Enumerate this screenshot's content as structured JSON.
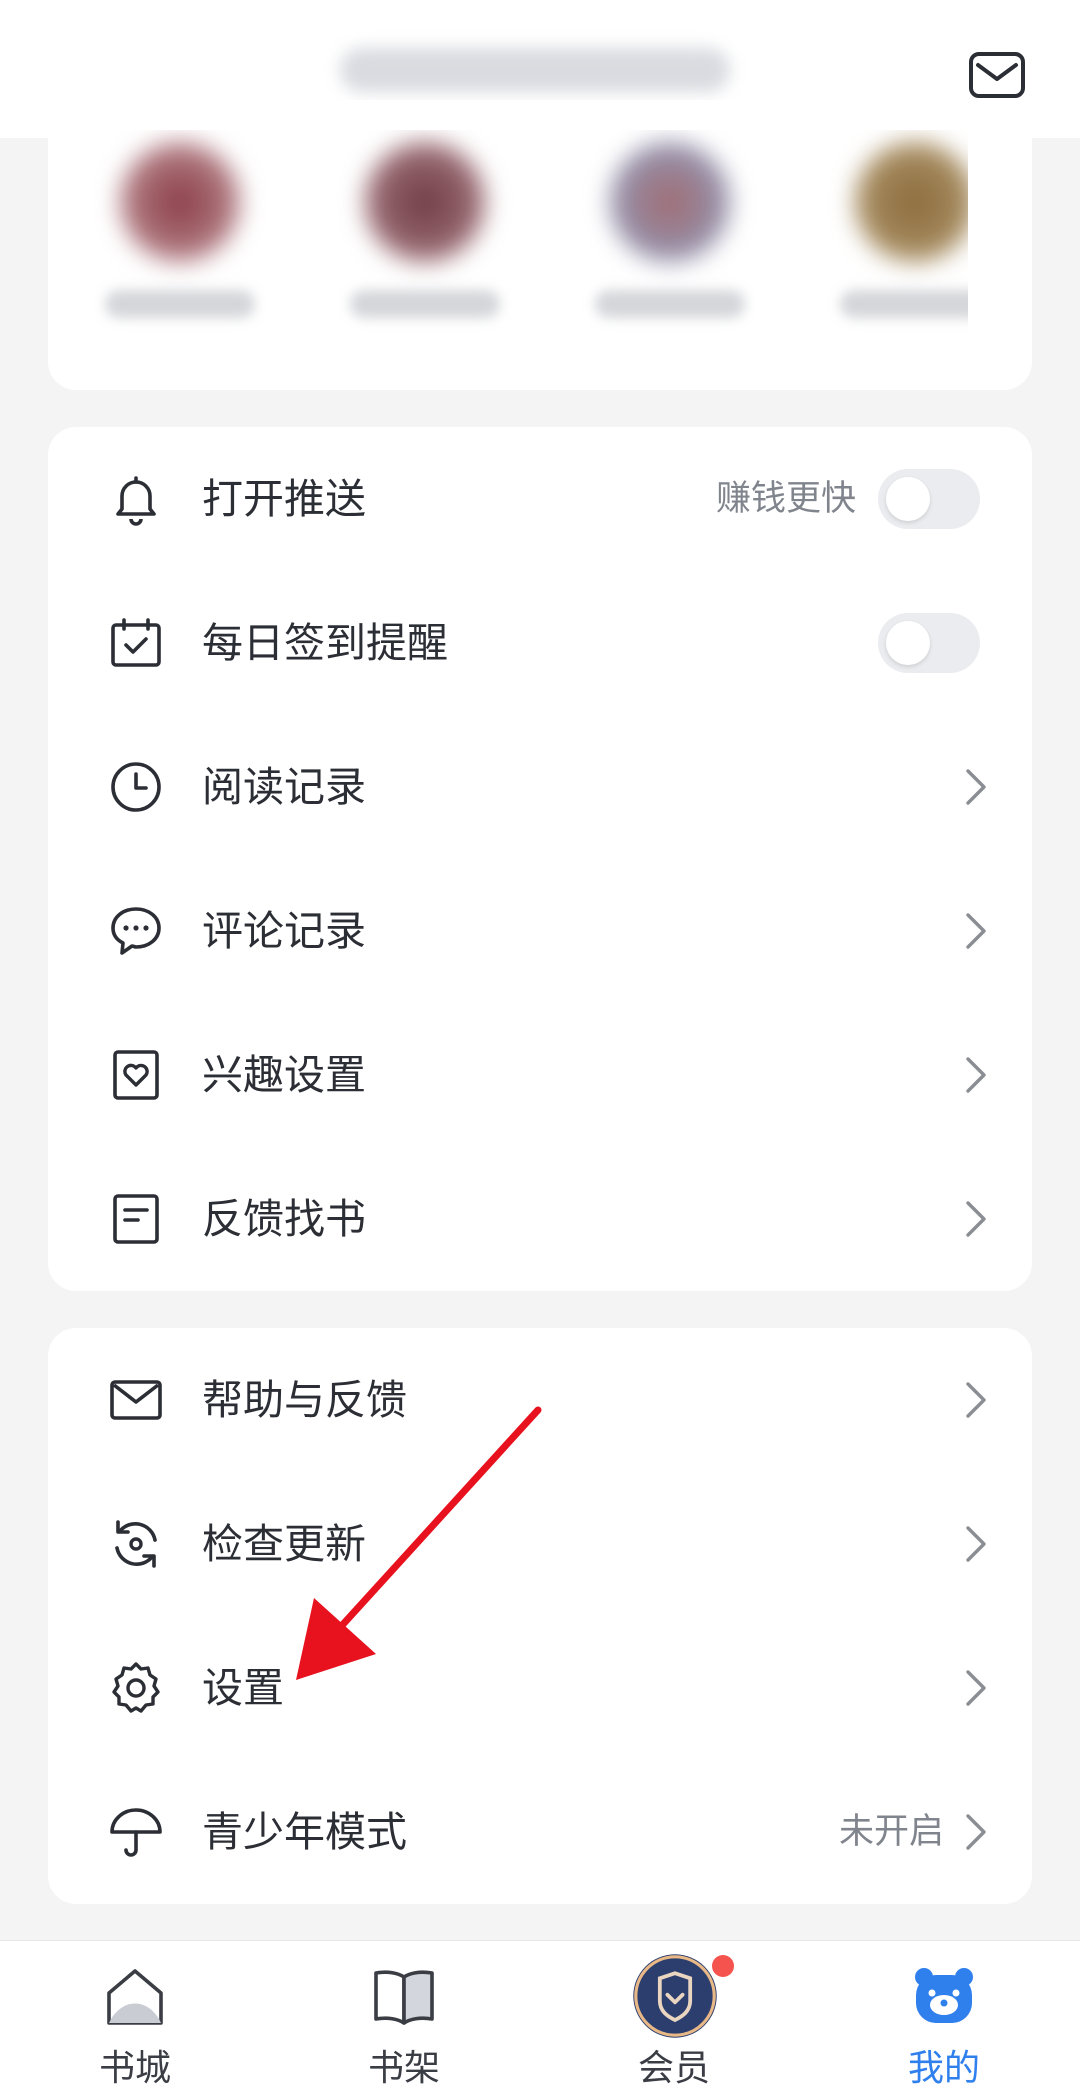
{
  "settings_group_1": {
    "items": [
      {
        "label": "打开推送",
        "hint": "赚钱更快",
        "control": "toggle",
        "checked": false
      },
      {
        "label": "每日签到提醒",
        "control": "toggle",
        "checked": false
      },
      {
        "label": "阅读记录",
        "control": "chevron"
      },
      {
        "label": "评论记录",
        "control": "chevron"
      },
      {
        "label": "兴趣设置",
        "control": "chevron"
      },
      {
        "label": "反馈找书",
        "control": "chevron"
      }
    ]
  },
  "settings_group_2": {
    "items": [
      {
        "label": "帮助与反馈",
        "control": "chevron"
      },
      {
        "label": "检查更新",
        "control": "chevron"
      },
      {
        "label": "设置",
        "control": "chevron"
      },
      {
        "label": "青少年模式",
        "hint": "未开启",
        "control": "chevron"
      }
    ]
  },
  "bottom_nav": {
    "tabs": [
      {
        "label": "书城",
        "icon": "home-icon"
      },
      {
        "label": "书架",
        "icon": "book-icon"
      },
      {
        "label": "会员",
        "icon": "vip-shield-icon",
        "badge": true
      },
      {
        "label": "我的",
        "icon": "profile-bear-icon",
        "active": true
      }
    ]
  },
  "colors": {
    "accent": "#2f80ed",
    "annotation_arrow": "#e8121f",
    "badge": "#f4534e"
  }
}
